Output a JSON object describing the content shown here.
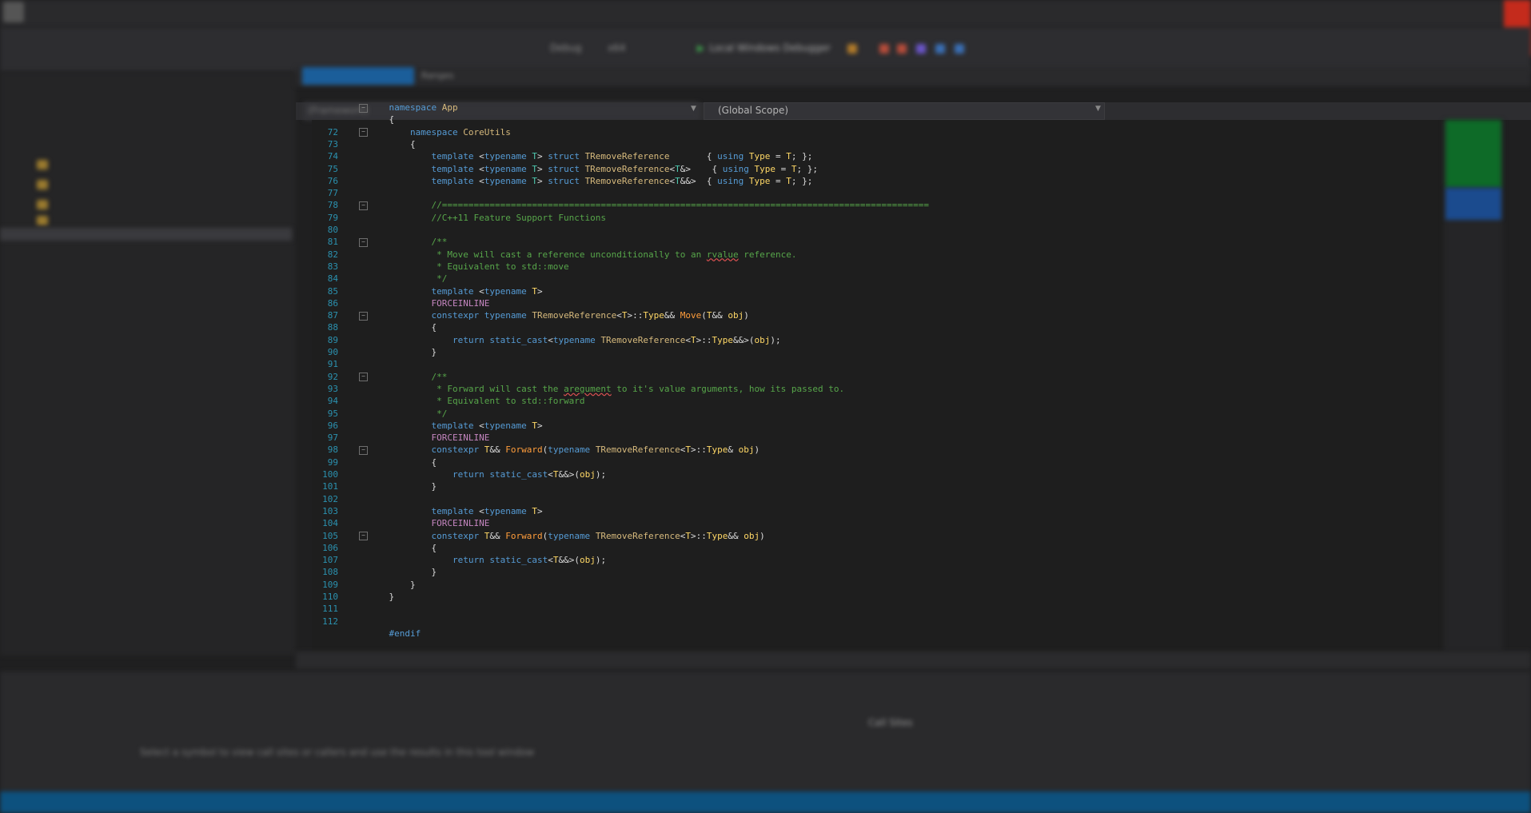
{
  "toolbar": {
    "configuration": "Debug",
    "platform": "x64",
    "debugger_label": "Local Windows Debugger"
  },
  "tabs": {
    "second_label": "Ranges"
  },
  "navigation": {
    "project_label": "(Framework)",
    "scope_label": "(Global Scope)"
  },
  "editor": {
    "lines": [
      {
        "n": "",
        "fold": true,
        "tokens": [
          [
            "kw",
            "namespace "
          ],
          [
            "tp",
            "App"
          ]
        ]
      },
      {
        "n": "",
        "fold": false,
        "tokens": [
          [
            "ct",
            "{"
          ]
        ]
      },
      {
        "n": "72",
        "fold": true,
        "tokens": [
          [
            "ct",
            "    "
          ],
          [
            "kw",
            "namespace "
          ],
          [
            "tp",
            "CoreUtils"
          ]
        ]
      },
      {
        "n": "73",
        "fold": false,
        "tokens": [
          [
            "ct",
            "    {"
          ]
        ]
      },
      {
        "n": "74",
        "fold": false,
        "tokens": [
          [
            "ct",
            "        "
          ],
          [
            "kw",
            "template "
          ],
          [
            "ct",
            "<"
          ],
          [
            "kw",
            "typename "
          ],
          [
            "ty",
            "T"
          ],
          [
            "ct",
            "> "
          ],
          [
            "kw",
            "struct "
          ],
          [
            "tp",
            "TRemoveReference"
          ],
          [
            "ct",
            "       { "
          ],
          [
            "kw",
            "using "
          ],
          [
            "tyl",
            "Type"
          ],
          [
            "ct",
            " = "
          ],
          [
            "tyl",
            "T"
          ],
          [
            "ct",
            "; };"
          ]
        ]
      },
      {
        "n": "75",
        "fold": false,
        "tokens": [
          [
            "ct",
            "        "
          ],
          [
            "kw",
            "template "
          ],
          [
            "ct",
            "<"
          ],
          [
            "kw",
            "typename "
          ],
          [
            "ty",
            "T"
          ],
          [
            "ct",
            "> "
          ],
          [
            "kw",
            "struct "
          ],
          [
            "tp",
            "TRemoveReference"
          ],
          [
            "ct",
            "<"
          ],
          [
            "ty",
            "T"
          ],
          [
            "ct",
            "&>    { "
          ],
          [
            "kw",
            "using "
          ],
          [
            "tyl",
            "Type"
          ],
          [
            "ct",
            " = "
          ],
          [
            "tyl",
            "T"
          ],
          [
            "ct",
            "; };"
          ]
        ]
      },
      {
        "n": "76",
        "fold": false,
        "tokens": [
          [
            "ct",
            "        "
          ],
          [
            "kw",
            "template "
          ],
          [
            "ct",
            "<"
          ],
          [
            "kw",
            "typename "
          ],
          [
            "ty",
            "T"
          ],
          [
            "ct",
            "> "
          ],
          [
            "kw",
            "struct "
          ],
          [
            "tp",
            "TRemoveReference"
          ],
          [
            "ct",
            "<"
          ],
          [
            "ty",
            "T"
          ],
          [
            "ct",
            "&&>  { "
          ],
          [
            "kw",
            "using "
          ],
          [
            "tyl",
            "Type"
          ],
          [
            "ct",
            " = "
          ],
          [
            "tyl",
            "T"
          ],
          [
            "ct",
            "; };"
          ]
        ]
      },
      {
        "n": "77",
        "fold": false,
        "tokens": []
      },
      {
        "n": "78",
        "fold": true,
        "tokens": [
          [
            "ct",
            "        "
          ],
          [
            "cm",
            "//============================================================================================"
          ]
        ]
      },
      {
        "n": "79",
        "fold": false,
        "tokens": [
          [
            "ct",
            "        "
          ],
          [
            "cm",
            "//C++11 Feature Support Functions"
          ]
        ]
      },
      {
        "n": "80",
        "fold": false,
        "tokens": []
      },
      {
        "n": "81",
        "fold": true,
        "tokens": [
          [
            "ct",
            "        "
          ],
          [
            "cm",
            "/**"
          ]
        ]
      },
      {
        "n": "82",
        "fold": false,
        "tokens": [
          [
            "ct",
            "        "
          ],
          [
            "cm",
            " * Move will cast a reference unconditionally to an "
          ],
          [
            "cmsq",
            "rvalue"
          ],
          [
            "cm",
            " reference."
          ]
        ]
      },
      {
        "n": "83",
        "fold": false,
        "tokens": [
          [
            "ct",
            "        "
          ],
          [
            "cm",
            " * Equivalent to std::move"
          ]
        ]
      },
      {
        "n": "84",
        "fold": false,
        "tokens": [
          [
            "ct",
            "        "
          ],
          [
            "cm",
            " */"
          ]
        ]
      },
      {
        "n": "85",
        "fold": false,
        "tokens": [
          [
            "ct",
            "        "
          ],
          [
            "kw",
            "template "
          ],
          [
            "ct",
            "<"
          ],
          [
            "kw",
            "typename "
          ],
          [
            "tyl",
            "T"
          ],
          [
            "ct",
            ">"
          ]
        ]
      },
      {
        "n": "86",
        "fold": false,
        "tokens": [
          [
            "ct",
            "        "
          ],
          [
            "mc",
            "FORCEINLINE"
          ]
        ]
      },
      {
        "n": "87",
        "fold": true,
        "tokens": [
          [
            "ct",
            "        "
          ],
          [
            "kw",
            "constexpr typename "
          ],
          [
            "tp",
            "TRemoveReference"
          ],
          [
            "ct",
            "<"
          ],
          [
            "tyl",
            "T"
          ],
          [
            "ct",
            ">::"
          ],
          [
            "tyl",
            "Type"
          ],
          [
            "ct",
            "&& "
          ],
          [
            "fn",
            "Move"
          ],
          [
            "ct",
            "("
          ],
          [
            "tyl",
            "T"
          ],
          [
            "ct",
            "&& "
          ],
          [
            "tyl",
            "obj"
          ],
          [
            "ct",
            ")"
          ]
        ]
      },
      {
        "n": "88",
        "fold": false,
        "tokens": [
          [
            "ct",
            "        {"
          ]
        ]
      },
      {
        "n": "89",
        "fold": false,
        "tokens": [
          [
            "ct",
            "            "
          ],
          [
            "kw",
            "return static_cast"
          ],
          [
            "ct",
            "<"
          ],
          [
            "kw",
            "typename "
          ],
          [
            "tp",
            "TRemoveReference"
          ],
          [
            "ct",
            "<"
          ],
          [
            "tyl",
            "T"
          ],
          [
            "ct",
            ">::"
          ],
          [
            "tyl",
            "Type"
          ],
          [
            "ct",
            "&&>("
          ],
          [
            "tyl",
            "obj"
          ],
          [
            "ct",
            ");"
          ]
        ]
      },
      {
        "n": "90",
        "fold": false,
        "tokens": [
          [
            "ct",
            "        }"
          ]
        ]
      },
      {
        "n": "91",
        "fold": false,
        "tokens": []
      },
      {
        "n": "92",
        "fold": true,
        "tokens": [
          [
            "ct",
            "        "
          ],
          [
            "cm",
            "/**"
          ]
        ]
      },
      {
        "n": "93",
        "fold": false,
        "tokens": [
          [
            "ct",
            "        "
          ],
          [
            "cm",
            " * Forward will cast the "
          ],
          [
            "cmsq",
            "aregument"
          ],
          [
            "cm",
            " to it's value arguments, how its passed to."
          ]
        ]
      },
      {
        "n": "94",
        "fold": false,
        "tokens": [
          [
            "ct",
            "        "
          ],
          [
            "cm",
            " * Equivalent to std::forward"
          ]
        ]
      },
      {
        "n": "95",
        "fold": false,
        "tokens": [
          [
            "ct",
            "        "
          ],
          [
            "cm",
            " */"
          ]
        ]
      },
      {
        "n": "96",
        "fold": false,
        "tokens": [
          [
            "ct",
            "        "
          ],
          [
            "kw",
            "template "
          ],
          [
            "ct",
            "<"
          ],
          [
            "kw",
            "typename "
          ],
          [
            "tyl",
            "T"
          ],
          [
            "ct",
            ">"
          ]
        ]
      },
      {
        "n": "97",
        "fold": false,
        "tokens": [
          [
            "ct",
            "        "
          ],
          [
            "mc",
            "FORCEINLINE"
          ]
        ]
      },
      {
        "n": "98",
        "fold": true,
        "tokens": [
          [
            "ct",
            "        "
          ],
          [
            "kw",
            "constexpr "
          ],
          [
            "tyl",
            "T"
          ],
          [
            "ct",
            "&& "
          ],
          [
            "fn",
            "Forward"
          ],
          [
            "ct",
            "("
          ],
          [
            "kw",
            "typename "
          ],
          [
            "tp",
            "TRemoveReference"
          ],
          [
            "ct",
            "<"
          ],
          [
            "tyl",
            "T"
          ],
          [
            "ct",
            ">::"
          ],
          [
            "tyl",
            "Type"
          ],
          [
            "ct",
            "& "
          ],
          [
            "tyl",
            "obj"
          ],
          [
            "ct",
            ")"
          ]
        ]
      },
      {
        "n": "99",
        "fold": false,
        "tokens": [
          [
            "ct",
            "        {"
          ]
        ]
      },
      {
        "n": "100",
        "fold": false,
        "tokens": [
          [
            "ct",
            "            "
          ],
          [
            "kw",
            "return static_cast"
          ],
          [
            "ct",
            "<"
          ],
          [
            "tyl",
            "T"
          ],
          [
            "ct",
            "&&>("
          ],
          [
            "tyl",
            "obj"
          ],
          [
            "ct",
            ");"
          ]
        ]
      },
      {
        "n": "101",
        "fold": false,
        "tokens": [
          [
            "ct",
            "        }"
          ]
        ]
      },
      {
        "n": "102",
        "fold": false,
        "tokens": []
      },
      {
        "n": "103",
        "fold": false,
        "tokens": [
          [
            "ct",
            "        "
          ],
          [
            "kw",
            "template "
          ],
          [
            "ct",
            "<"
          ],
          [
            "kw",
            "typename "
          ],
          [
            "tyl",
            "T"
          ],
          [
            "ct",
            ">"
          ]
        ]
      },
      {
        "n": "104",
        "fold": false,
        "tokens": [
          [
            "ct",
            "        "
          ],
          [
            "mc",
            "FORCEINLINE"
          ]
        ]
      },
      {
        "n": "105",
        "fold": true,
        "tokens": [
          [
            "ct",
            "        "
          ],
          [
            "kw",
            "constexpr "
          ],
          [
            "tyl",
            "T"
          ],
          [
            "ct",
            "&& "
          ],
          [
            "fn",
            "Forward"
          ],
          [
            "ct",
            "("
          ],
          [
            "kw",
            "typename "
          ],
          [
            "tp",
            "TRemoveReference"
          ],
          [
            "ct",
            "<"
          ],
          [
            "tyl",
            "T"
          ],
          [
            "ct",
            ">::"
          ],
          [
            "tyl",
            "Type"
          ],
          [
            "ct",
            "&& "
          ],
          [
            "tyl",
            "obj"
          ],
          [
            "ct",
            ")"
          ]
        ]
      },
      {
        "n": "106",
        "fold": false,
        "tokens": [
          [
            "ct",
            "        {"
          ]
        ]
      },
      {
        "n": "107",
        "fold": false,
        "tokens": [
          [
            "ct",
            "            "
          ],
          [
            "kw",
            "return static_cast"
          ],
          [
            "ct",
            "<"
          ],
          [
            "tyl",
            "T"
          ],
          [
            "ct",
            "&&>("
          ],
          [
            "tyl",
            "obj"
          ],
          [
            "ct",
            ");"
          ]
        ]
      },
      {
        "n": "108",
        "fold": false,
        "tokens": [
          [
            "ct",
            "        }"
          ]
        ]
      },
      {
        "n": "109",
        "fold": false,
        "tokens": [
          [
            "ct",
            "    }"
          ]
        ]
      },
      {
        "n": "110",
        "fold": false,
        "tokens": [
          [
            "ct",
            "}"
          ]
        ]
      },
      {
        "n": "111",
        "fold": false,
        "tokens": []
      },
      {
        "n": "112",
        "fold": false,
        "tokens": []
      },
      {
        "n": "",
        "fold": false,
        "tokens": [
          [
            "kw",
            "#endif"
          ]
        ]
      }
    ]
  },
  "bottom_panel": {
    "title": "Call Sites",
    "message": "Select a symbol to view call sites or callers and use the results in this tool window"
  }
}
